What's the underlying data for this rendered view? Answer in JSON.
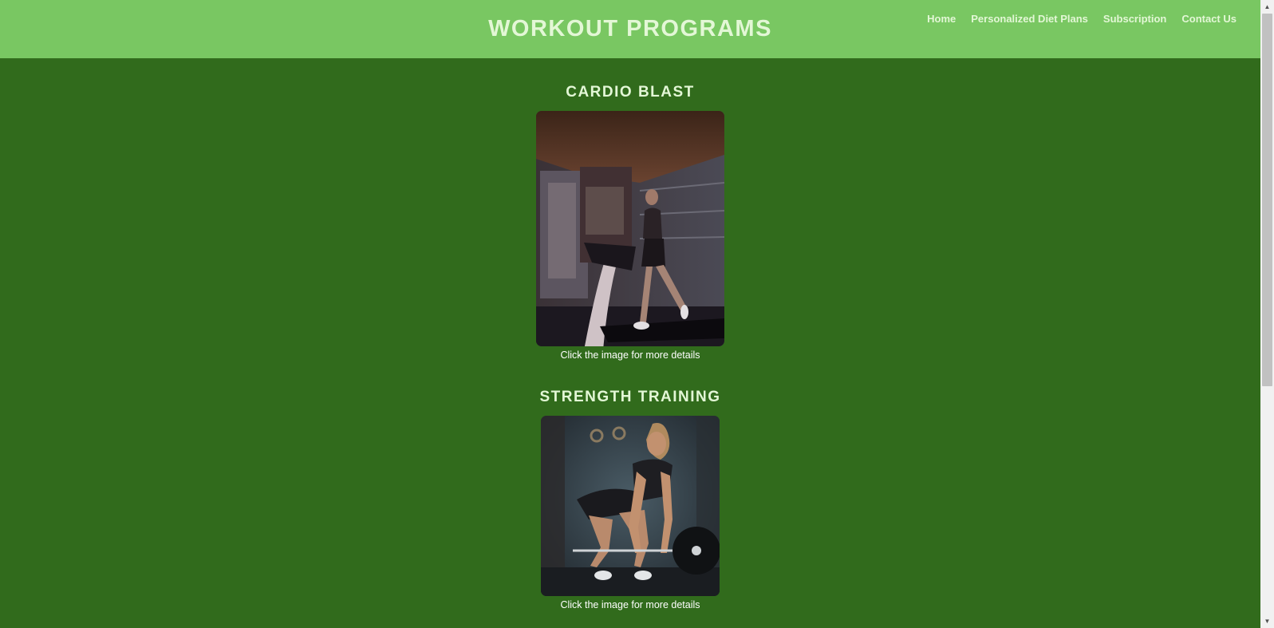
{
  "header": {
    "title": "WORKOUT PROGRAMS",
    "nav": [
      "Home",
      "Personalized Diet Plans",
      "Subscription",
      "Contact Us"
    ]
  },
  "programs": [
    {
      "title": "CARDIO BLAST",
      "caption": "Click the image for more details"
    },
    {
      "title": "STRENGTH TRAINING",
      "caption": "Click the image for more details"
    }
  ],
  "colors": {
    "header_bg": "#79c762",
    "page_bg": "#316b1c",
    "heading_text": "#e3f7d6",
    "caption_text": "#ffffff"
  }
}
